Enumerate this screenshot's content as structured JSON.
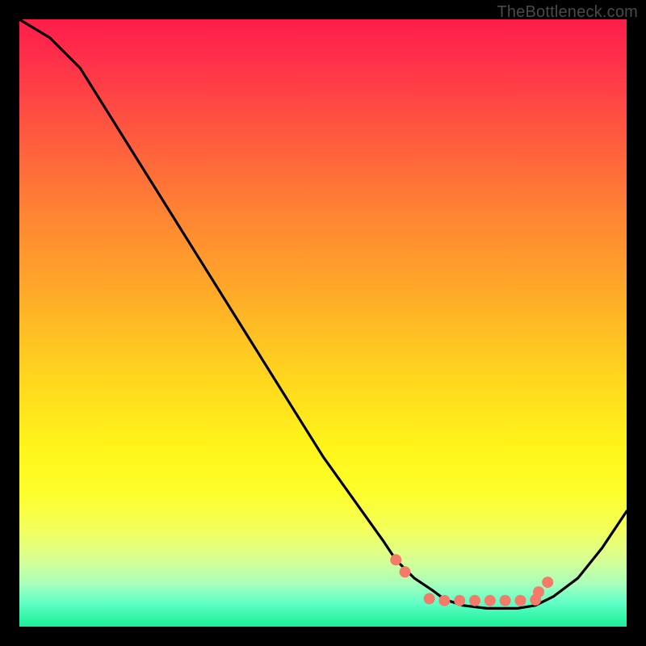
{
  "watermark": "TheBottleneck.com",
  "chart_data": {
    "type": "line",
    "title": "",
    "xlabel": "",
    "ylabel": "",
    "xlim": [
      0,
      100
    ],
    "ylim": [
      0,
      100
    ],
    "series": [
      {
        "name": "curve",
        "x": [
          0,
          5,
          10,
          15,
          20,
          25,
          30,
          35,
          40,
          45,
          50,
          55,
          60,
          62,
          65,
          68,
          70,
          73,
          77,
          82,
          85,
          88,
          92,
          96,
          100
        ],
        "y": [
          100,
          97,
          92,
          84,
          76,
          68,
          60,
          52,
          44,
          36,
          28,
          21,
          14,
          11,
          8,
          6,
          4.5,
          3.5,
          3,
          3,
          3.5,
          5,
          8,
          13,
          19
        ]
      }
    ],
    "dots": {
      "x": [
        62,
        63.5,
        67.5,
        70,
        72.5,
        75,
        77.5,
        80,
        82.5,
        85,
        85.5,
        87
      ],
      "y": [
        11,
        9,
        4.6,
        4.3,
        4.3,
        4.3,
        4.3,
        4.3,
        4.3,
        4.4,
        5.7,
        7.3
      ]
    },
    "colors": {
      "curve": "#000000",
      "dots": "#f47a6a",
      "gradient_top": "#ff1d4a",
      "gradient_mid": "#ffe31a",
      "gradient_bottom": "#18ef96"
    }
  }
}
